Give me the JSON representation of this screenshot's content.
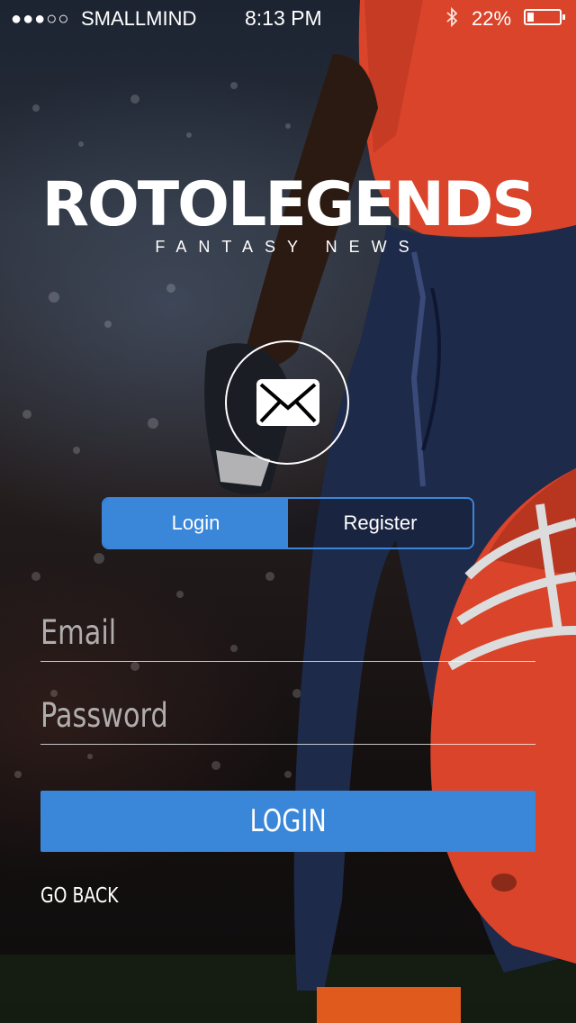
{
  "status_bar": {
    "signal": "●●●○○",
    "carrier": "SMALLMIND",
    "time": "8:13 PM",
    "bluetooth_icon": "bluetooth-icon",
    "battery_percent": "22%"
  },
  "logo": {
    "title": "ROTOLEGENDS",
    "subtitle": "FANTASY NEWS"
  },
  "mail_icon": "envelope-icon",
  "segment": {
    "login_label": "Login",
    "register_label": "Register",
    "active": "Login"
  },
  "form": {
    "email_placeholder": "Email",
    "email_value": "",
    "password_placeholder": "Password",
    "password_value": ""
  },
  "buttons": {
    "login_label": "LOGIN",
    "go_back_label": "GO BACK"
  },
  "colors": {
    "accent": "#3a86d8",
    "jersey": "#d9442a",
    "pants": "#1e2a4a"
  }
}
